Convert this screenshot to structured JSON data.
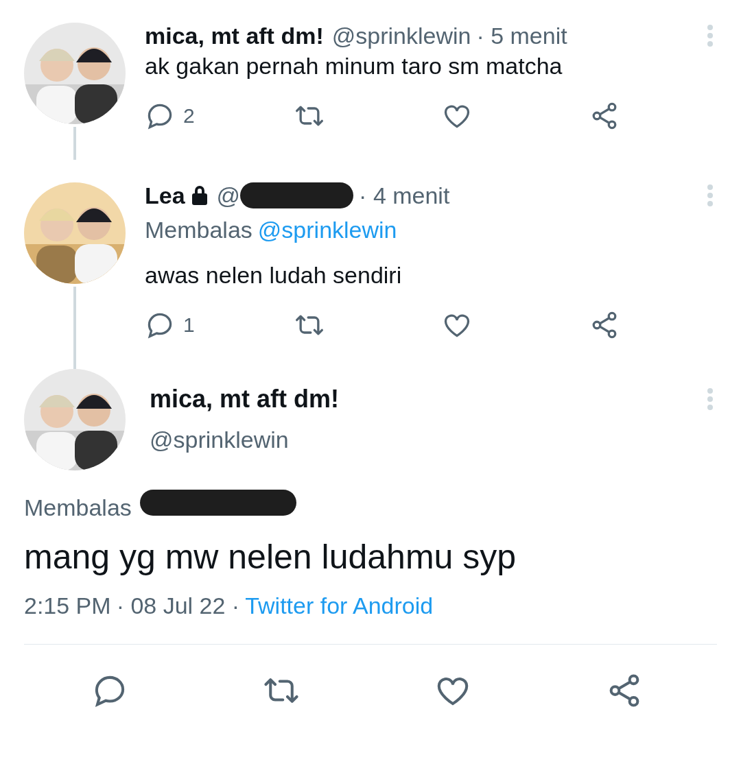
{
  "replies": [
    {
      "name": "mica, mt aft dm!",
      "locked": false,
      "handle": "@sprinklewin",
      "handle_redacted": false,
      "time": "· 5 menit",
      "text": "ak gakan pernah minum taro sm matcha",
      "reply_count": "2"
    },
    {
      "name": "Lea",
      "locked": true,
      "handle": "@",
      "handle_redacted": true,
      "time": "· 4 menit",
      "reply_label": "Membalas",
      "reply_to": "@sprinklewin",
      "text": "awas nelen ludah sendiri",
      "reply_count": "1"
    }
  ],
  "main_tweet": {
    "name": "mica, mt aft dm!",
    "handle": "@sprinklewin",
    "reply_label": "Membalas",
    "text": "mang yg mw nelen ludahmu syp",
    "time": "2:15 PM",
    "date": "· 08 Jul 22 ·",
    "source": "Twitter for Android"
  }
}
